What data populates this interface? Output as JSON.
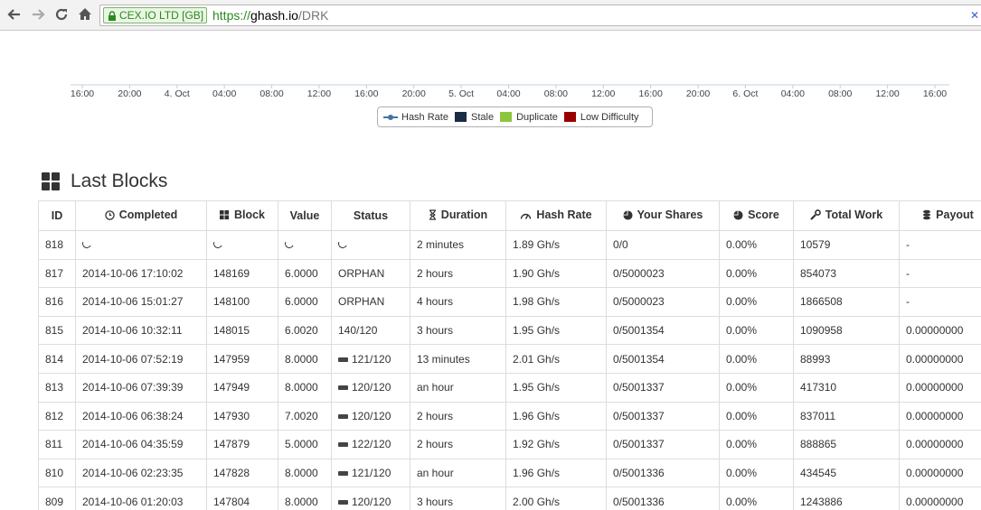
{
  "browser": {
    "ev_label": "CEX.IO LTD [GB]",
    "url_proto": "https://",
    "url_host": "ghash.io",
    "url_path": "/DRK"
  },
  "chart_data": {
    "type": "line",
    "x_ticks": [
      "16:00",
      "20:00",
      "4. Oct",
      "04:00",
      "08:00",
      "12:00",
      "16:00",
      "20:00",
      "5. Oct",
      "04:00",
      "08:00",
      "12:00",
      "16:00",
      "20:00",
      "6. Oct",
      "04:00",
      "08:00",
      "12:00",
      "16:00"
    ],
    "series": [
      {
        "name": "Hash Rate",
        "color": "#4572a7"
      },
      {
        "name": "Stale",
        "color": "#1a2b45"
      },
      {
        "name": "Duplicate",
        "color": "#8cc63e"
      },
      {
        "name": "Low Difficulty",
        "color": "#990000"
      }
    ],
    "legend_placement": "bottom-center"
  },
  "section": {
    "title": "Last Blocks"
  },
  "table": {
    "headers": [
      "ID",
      "Completed",
      "Block",
      "Value",
      "Status",
      "Duration",
      "Hash Rate",
      "Your Shares",
      "Score",
      "Total Work",
      "Payout"
    ],
    "header_icons": [
      "",
      "clock-icon",
      "blocks-icon",
      "",
      "",
      "hourglass-icon",
      "dashboard-icon",
      "pie-icon",
      "pie-icon",
      "wrench-icon",
      "coins-icon"
    ],
    "rows": [
      {
        "id": "818",
        "completed": "",
        "block": "",
        "value": "",
        "status": "",
        "duration": "2 minutes",
        "hashrate": "1.89 Gh/s",
        "shares": "0/0",
        "score": "0.00%",
        "work": "10579",
        "payout": "-",
        "pending": true,
        "brick": false
      },
      {
        "id": "817",
        "completed": "2014-10-06 17:10:02",
        "block": "148169",
        "value": "6.0000",
        "status": "ORPHAN",
        "duration": "2 hours",
        "hashrate": "1.90 Gh/s",
        "shares": "0/5000023",
        "score": "0.00%",
        "work": "854073",
        "payout": "-",
        "pending": false,
        "brick": false
      },
      {
        "id": "816",
        "completed": "2014-10-06 15:01:27",
        "block": "148100",
        "value": "6.0000",
        "status": "ORPHAN",
        "duration": "4 hours",
        "hashrate": "1.98 Gh/s",
        "shares": "0/5000023",
        "score": "0.00%",
        "work": "1866508",
        "payout": "-",
        "pending": false,
        "brick": false
      },
      {
        "id": "815",
        "completed": "2014-10-06 10:32:11",
        "block": "148015",
        "value": "6.0020",
        "status": "140/120",
        "duration": "3 hours",
        "hashrate": "1.95 Gh/s",
        "shares": "0/5001354",
        "score": "0.00%",
        "work": "1090958",
        "payout": "0.00000000",
        "pending": false,
        "brick": false
      },
      {
        "id": "814",
        "completed": "2014-10-06 07:52:19",
        "block": "147959",
        "value": "8.0000",
        "status": "121/120",
        "duration": "13 minutes",
        "hashrate": "2.01 Gh/s",
        "shares": "0/5001354",
        "score": "0.00%",
        "work": "88993",
        "payout": "0.00000000",
        "pending": false,
        "brick": true
      },
      {
        "id": "813",
        "completed": "2014-10-06 07:39:39",
        "block": "147949",
        "value": "8.0000",
        "status": "120/120",
        "duration": "an hour",
        "hashrate": "1.95 Gh/s",
        "shares": "0/5001337",
        "score": "0.00%",
        "work": "417310",
        "payout": "0.00000000",
        "pending": false,
        "brick": true
      },
      {
        "id": "812",
        "completed": "2014-10-06 06:38:24",
        "block": "147930",
        "value": "7.0020",
        "status": "120/120",
        "duration": "2 hours",
        "hashrate": "1.96 Gh/s",
        "shares": "0/5001337",
        "score": "0.00%",
        "work": "837011",
        "payout": "0.00000000",
        "pending": false,
        "brick": true
      },
      {
        "id": "811",
        "completed": "2014-10-06 04:35:59",
        "block": "147879",
        "value": "5.0000",
        "status": "122/120",
        "duration": "2 hours",
        "hashrate": "1.92 Gh/s",
        "shares": "0/5001337",
        "score": "0.00%",
        "work": "888865",
        "payout": "0.00000000",
        "pending": false,
        "brick": true
      },
      {
        "id": "810",
        "completed": "2014-10-06 02:23:35",
        "block": "147828",
        "value": "8.0000",
        "status": "121/120",
        "duration": "an hour",
        "hashrate": "1.96 Gh/s",
        "shares": "0/5001336",
        "score": "0.00%",
        "work": "434545",
        "payout": "0.00000000",
        "pending": false,
        "brick": true
      },
      {
        "id": "809",
        "completed": "2014-10-06 01:20:03",
        "block": "147804",
        "value": "8.0000",
        "status": "120/120",
        "duration": "3 hours",
        "hashrate": "2.00 Gh/s",
        "shares": "0/5001336",
        "score": "0.00%",
        "work": "1243886",
        "payout": "0.00000000",
        "pending": false,
        "brick": true
      }
    ]
  }
}
